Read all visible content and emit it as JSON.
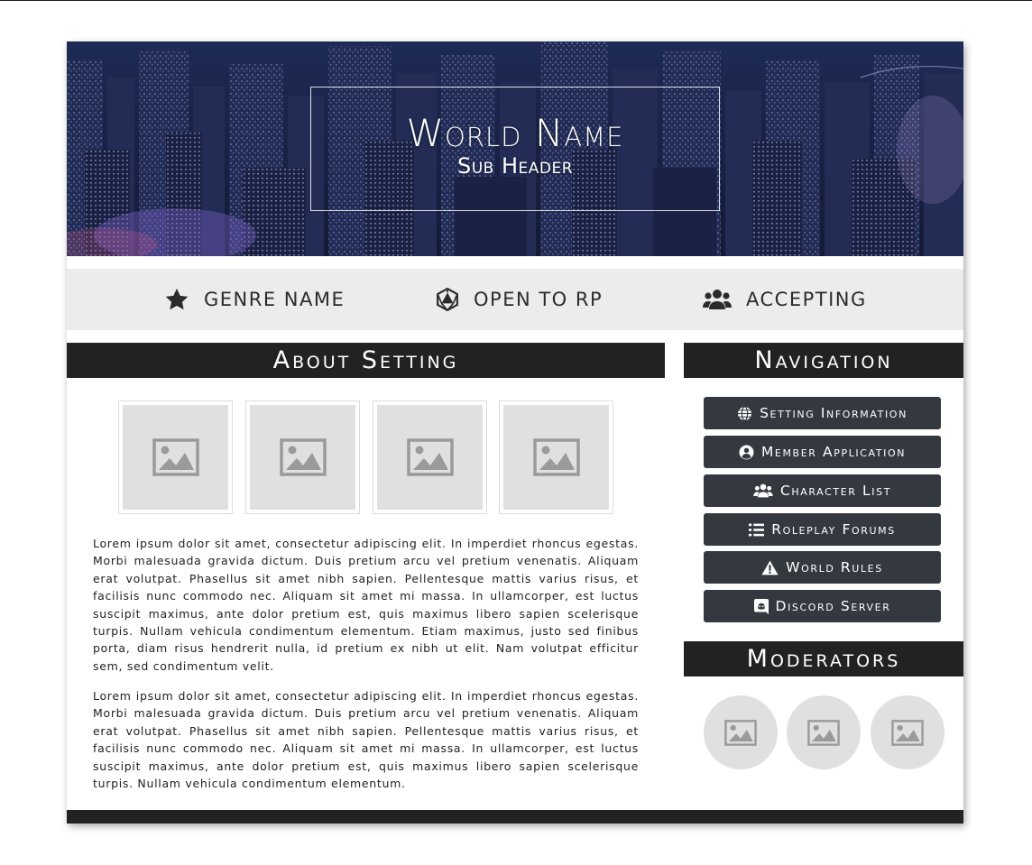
{
  "banner": {
    "title": "World Name",
    "subtitle": "Sub Header"
  },
  "status_bar": {
    "items": [
      {
        "icon": "star-icon",
        "label": "GENRE NAME"
      },
      {
        "icon": "d20-icon",
        "label": "OPEN TO RP"
      },
      {
        "icon": "users-icon",
        "label": "ACCEPTING"
      }
    ]
  },
  "about": {
    "heading": "About Setting",
    "gallery_icon": "image-placeholder-icon",
    "paragraphs": [
      "Lorem ipsum dolor sit amet, consectetur adipiscing elit. In imperdiet rhoncus egestas. Morbi malesuada gravida dictum. Duis pretium arcu vel pretium venenatis. Aliquam erat volutpat. Phasellus sit amet nibh sapien. Pellentesque mattis varius risus, et facilisis nunc commodo nec. Aliquam sit amet mi massa. In ullamcorper, est luctus suscipit maximus, ante dolor pretium est, quis maximus libero sapien scelerisque turpis. Nullam vehicula condimentum elementum. Etiam maximus, justo sed finibus porta, diam risus hendrerit nulla, id pretium ex nibh ut elit. Nam volutpat efficitur sem, sed condimentum velit.",
      "Lorem ipsum dolor sit amet, consectetur adipiscing elit. In imperdiet rhoncus egestas. Morbi malesuada gravida dictum. Duis pretium arcu vel pretium venenatis. Aliquam erat volutpat. Phasellus sit amet nibh sapien. Pellentesque mattis varius risus, et facilisis nunc commodo nec. Aliquam sit amet mi massa. In ullamcorper, est luctus suscipit maximus, ante dolor pretium est, quis maximus libero sapien scelerisque turpis. Nullam vehicula condimentum elementum."
    ]
  },
  "navigation": {
    "heading": "Navigation",
    "buttons": [
      {
        "icon": "globe-icon",
        "label": "Setting Information"
      },
      {
        "icon": "user-circle-icon",
        "label": "Member Application"
      },
      {
        "icon": "users-icon",
        "label": "Character List"
      },
      {
        "icon": "list-icon",
        "label": "Roleplay Forums"
      },
      {
        "icon": "warning-icon",
        "label": "World Rules"
      },
      {
        "icon": "discord-icon",
        "label": "Discord Server"
      }
    ]
  },
  "moderators": {
    "heading": "Moderators"
  },
  "colors": {
    "dark": "#222222",
    "button": "#343940",
    "status_bg": "#ececec",
    "placeholder": "#e0e0e0"
  }
}
